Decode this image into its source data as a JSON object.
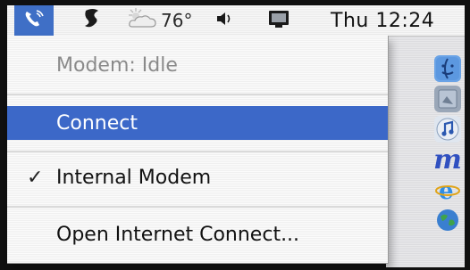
{
  "menubar": {
    "weather_temp": "76°",
    "clock": "Thu 12:24"
  },
  "modem_menu": {
    "status": "Modem: Idle",
    "connect": "Connect",
    "internal_modem": "Internal Modem",
    "internal_modem_checked": true,
    "check_glyph": "✓",
    "open_internet_connect": "Open Internet Connect..."
  },
  "icons": {
    "menubar": [
      "phone-modem-icon",
      "script-menu-icon",
      "weather-cloud-icon",
      "volume-icon",
      "display-icon"
    ],
    "dock": [
      "finder-icon",
      "preview-icon",
      "itunes-icon",
      "m-app-icon",
      "internet-explorer-icon",
      "globe-icon"
    ]
  },
  "colors": {
    "highlight": "#3c68c8",
    "menubar_active": "#3f6fc6",
    "disabled_text": "#8a8a8a"
  }
}
